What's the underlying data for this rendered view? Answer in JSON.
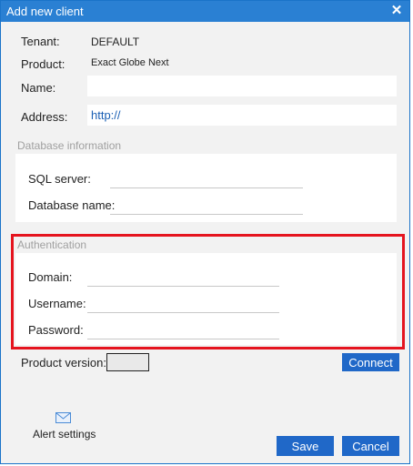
{
  "window": {
    "title": "Add new client"
  },
  "fields": {
    "tenant_label": "Tenant:",
    "tenant_value": "DEFAULT",
    "product_label": "Product:",
    "product_value": "Exact Globe Next",
    "name_label": "Name:",
    "name_value": "",
    "address_label": "Address:",
    "address_value": "http://"
  },
  "database": {
    "section_title": "Database information",
    "sql_server_label": "SQL server:",
    "sql_server_value": "",
    "database_name_label": "Database name:",
    "database_name_value": ""
  },
  "authentication": {
    "section_title": "Authentication",
    "domain_label": "Domain:",
    "domain_value": "",
    "username_label": "Username:",
    "username_value": "",
    "password_label": "Password:",
    "password_value": "",
    "highlight_color": "#e5141e"
  },
  "product_version": {
    "label": "Product version:",
    "value": ""
  },
  "buttons": {
    "connect": "Connect",
    "save": "Save",
    "cancel": "Cancel"
  },
  "alert_settings": {
    "label": "Alert settings",
    "icon": "envelope-icon"
  },
  "colors": {
    "titlebar": "#2a80d3",
    "button": "#2068c8",
    "link_text": "#1a5fb4"
  }
}
